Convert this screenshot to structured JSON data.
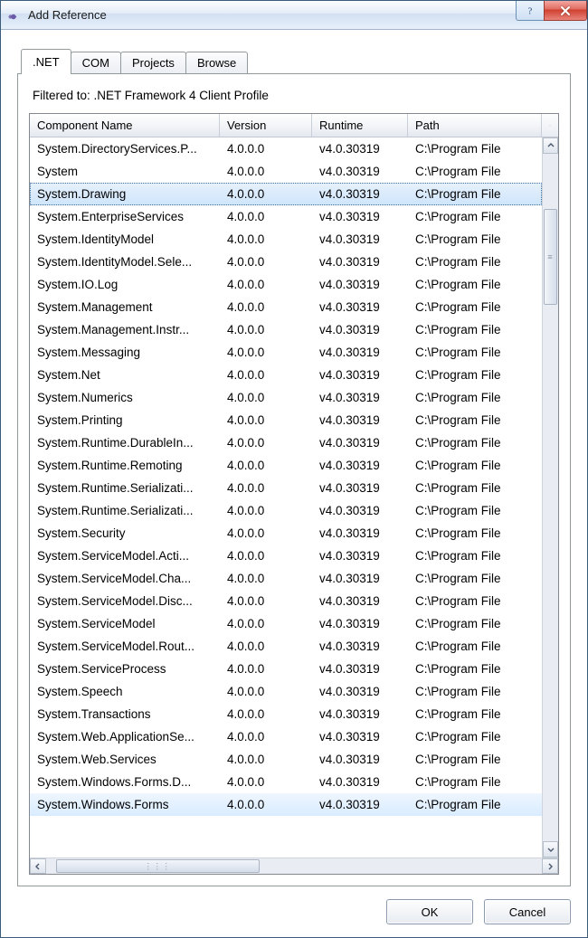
{
  "window": {
    "title": "Add Reference"
  },
  "titleButtons": {
    "help_aria": "Help",
    "close_aria": "Close"
  },
  "tabs": [
    {
      "label": ".NET",
      "active": true
    },
    {
      "label": "COM",
      "active": false
    },
    {
      "label": "Projects",
      "active": false
    },
    {
      "label": "Browse",
      "active": false
    }
  ],
  "filterLine": "Filtered to: .NET Framework 4 Client Profile",
  "columns": {
    "name": "Component Name",
    "version": "Version",
    "runtime": "Runtime",
    "path": "Path"
  },
  "rows": [
    {
      "name": "System.DirectoryServices.P...",
      "version": "4.0.0.0",
      "runtime": "v4.0.30319",
      "path": "C:\\Program File",
      "selected": false,
      "focused": false
    },
    {
      "name": "System",
      "version": "4.0.0.0",
      "runtime": "v4.0.30319",
      "path": "C:\\Program File",
      "selected": false,
      "focused": false
    },
    {
      "name": "System.Drawing",
      "version": "4.0.0.0",
      "runtime": "v4.0.30319",
      "path": "C:\\Program File",
      "selected": true,
      "focused": true
    },
    {
      "name": "System.EnterpriseServices",
      "version": "4.0.0.0",
      "runtime": "v4.0.30319",
      "path": "C:\\Program File",
      "selected": false,
      "focused": false
    },
    {
      "name": "System.IdentityModel",
      "version": "4.0.0.0",
      "runtime": "v4.0.30319",
      "path": "C:\\Program File",
      "selected": false,
      "focused": false
    },
    {
      "name": "System.IdentityModel.Sele...",
      "version": "4.0.0.0",
      "runtime": "v4.0.30319",
      "path": "C:\\Program File",
      "selected": false,
      "focused": false
    },
    {
      "name": "System.IO.Log",
      "version": "4.0.0.0",
      "runtime": "v4.0.30319",
      "path": "C:\\Program File",
      "selected": false,
      "focused": false
    },
    {
      "name": "System.Management",
      "version": "4.0.0.0",
      "runtime": "v4.0.30319",
      "path": "C:\\Program File",
      "selected": false,
      "focused": false
    },
    {
      "name": "System.Management.Instr...",
      "version": "4.0.0.0",
      "runtime": "v4.0.30319",
      "path": "C:\\Program File",
      "selected": false,
      "focused": false
    },
    {
      "name": "System.Messaging",
      "version": "4.0.0.0",
      "runtime": "v4.0.30319",
      "path": "C:\\Program File",
      "selected": false,
      "focused": false
    },
    {
      "name": "System.Net",
      "version": "4.0.0.0",
      "runtime": "v4.0.30319",
      "path": "C:\\Program File",
      "selected": false,
      "focused": false
    },
    {
      "name": "System.Numerics",
      "version": "4.0.0.0",
      "runtime": "v4.0.30319",
      "path": "C:\\Program File",
      "selected": false,
      "focused": false
    },
    {
      "name": "System.Printing",
      "version": "4.0.0.0",
      "runtime": "v4.0.30319",
      "path": "C:\\Program File",
      "selected": false,
      "focused": false
    },
    {
      "name": "System.Runtime.DurableIn...",
      "version": "4.0.0.0",
      "runtime": "v4.0.30319",
      "path": "C:\\Program File",
      "selected": false,
      "focused": false
    },
    {
      "name": "System.Runtime.Remoting",
      "version": "4.0.0.0",
      "runtime": "v4.0.30319",
      "path": "C:\\Program File",
      "selected": false,
      "focused": false
    },
    {
      "name": "System.Runtime.Serializati...",
      "version": "4.0.0.0",
      "runtime": "v4.0.30319",
      "path": "C:\\Program File",
      "selected": false,
      "focused": false
    },
    {
      "name": "System.Runtime.Serializati...",
      "version": "4.0.0.0",
      "runtime": "v4.0.30319",
      "path": "C:\\Program File",
      "selected": false,
      "focused": false
    },
    {
      "name": "System.Security",
      "version": "4.0.0.0",
      "runtime": "v4.0.30319",
      "path": "C:\\Program File",
      "selected": false,
      "focused": false
    },
    {
      "name": "System.ServiceModel.Acti...",
      "version": "4.0.0.0",
      "runtime": "v4.0.30319",
      "path": "C:\\Program File",
      "selected": false,
      "focused": false
    },
    {
      "name": "System.ServiceModel.Cha...",
      "version": "4.0.0.0",
      "runtime": "v4.0.30319",
      "path": "C:\\Program File",
      "selected": false,
      "focused": false
    },
    {
      "name": "System.ServiceModel.Disc...",
      "version": "4.0.0.0",
      "runtime": "v4.0.30319",
      "path": "C:\\Program File",
      "selected": false,
      "focused": false
    },
    {
      "name": "System.ServiceModel",
      "version": "4.0.0.0",
      "runtime": "v4.0.30319",
      "path": "C:\\Program File",
      "selected": false,
      "focused": false
    },
    {
      "name": "System.ServiceModel.Rout...",
      "version": "4.0.0.0",
      "runtime": "v4.0.30319",
      "path": "C:\\Program File",
      "selected": false,
      "focused": false
    },
    {
      "name": "System.ServiceProcess",
      "version": "4.0.0.0",
      "runtime": "v4.0.30319",
      "path": "C:\\Program File",
      "selected": false,
      "focused": false
    },
    {
      "name": "System.Speech",
      "version": "4.0.0.0",
      "runtime": "v4.0.30319",
      "path": "C:\\Program File",
      "selected": false,
      "focused": false
    },
    {
      "name": "System.Transactions",
      "version": "4.0.0.0",
      "runtime": "v4.0.30319",
      "path": "C:\\Program File",
      "selected": false,
      "focused": false
    },
    {
      "name": "System.Web.ApplicationSe...",
      "version": "4.0.0.0",
      "runtime": "v4.0.30319",
      "path": "C:\\Program File",
      "selected": false,
      "focused": false
    },
    {
      "name": "System.Web.Services",
      "version": "4.0.0.0",
      "runtime": "v4.0.30319",
      "path": "C:\\Program File",
      "selected": false,
      "focused": false
    },
    {
      "name": "System.Windows.Forms.D...",
      "version": "4.0.0.0",
      "runtime": "v4.0.30319",
      "path": "C:\\Program File",
      "selected": false,
      "focused": false
    },
    {
      "name": "System.Windows.Forms",
      "version": "4.0.0.0",
      "runtime": "v4.0.30319",
      "path": "C:\\Program File",
      "selected": true,
      "focused": false
    }
  ],
  "vscroll": {
    "thumb_top_pct": 8,
    "thumb_height_pct": 14
  },
  "hscroll": {
    "thumb_left_pct": 2,
    "thumb_width_pct": 41
  },
  "buttons": {
    "ok": "OK",
    "cancel": "Cancel"
  }
}
